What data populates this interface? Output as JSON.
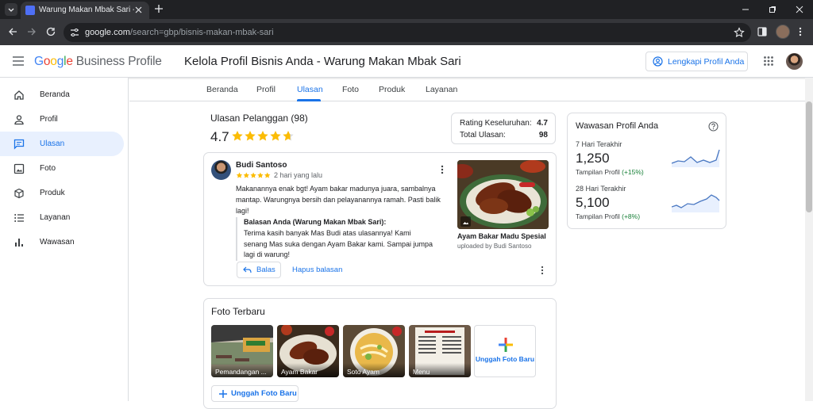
{
  "browser": {
    "tab_title": "Warung Makan Mbak Sari - W",
    "url_host": "google.com",
    "url_path": "/search=gbp/bisnis-makan-mbak-sari"
  },
  "header": {
    "logo_google": "Google",
    "logo_product": "Business Profile",
    "title": "Kelola Profil Bisnis Anda - Warung Makan Mbak Sari",
    "complete_button": "Lengkapi Profil Anda"
  },
  "sidebar": {
    "items": [
      {
        "label": "Beranda",
        "icon": "home-icon"
      },
      {
        "label": "Profil",
        "icon": "person-icon"
      },
      {
        "label": "Ulasan",
        "icon": "reviews-icon",
        "active": true
      },
      {
        "label": "Foto",
        "icon": "photo-icon"
      },
      {
        "label": "Produk",
        "icon": "product-box-icon"
      },
      {
        "label": "Layanan",
        "icon": "list-icon"
      },
      {
        "label": "Wawasan",
        "icon": "bar-chart-icon"
      }
    ]
  },
  "tabs": [
    "Beranda",
    "Profil",
    "Ulasan",
    "Foto",
    "Produk",
    "Layanan"
  ],
  "active_tab": "Ulasan",
  "reviews": {
    "heading": "Ulasan Pelanggan (98)",
    "average": "4.7",
    "rating_label": "Rating Keseluruhan:",
    "rating_value": "4.7",
    "total_label": "Total Ulasan:",
    "total_value": "98",
    "review": {
      "author": "Budi Santoso",
      "stars": 5,
      "time": "2 hari yang lalu",
      "text": "Makanannya enak bgt! Ayam bakar madunya juara, sambalnya mantap. Warungnya bersih dan pelayanannya ramah. Pasti balik lagi!",
      "reply_label": "Balasan Anda (Warung Makan Mbak Sari):",
      "reply_text": "Terima kasih banyak Mas Budi atas ulasannya! Kami senang Mas suka dengan Ayam Bakar kami. Sampai jumpa lagi di warung!",
      "reply_button": "Balas",
      "delete_reply": "Hapus balasan",
      "photo_title": "Ayam Bakar Madu Spesial",
      "photo_sub": "uploaded by Budi Santoso"
    }
  },
  "photos": {
    "heading": "Foto Terbaru",
    "items": [
      "Pemandangan ...",
      "Ayam Bakar",
      "Soto Ayam",
      "Menu"
    ],
    "upload_tile": "Unggah Foto Baru",
    "upload_button": "Unggah Foto Baru"
  },
  "insights": {
    "title": "Wawasan Profil Anda",
    "periods": [
      {
        "label": "7 Hari Terakhir",
        "value": "1,250",
        "sub": "Tampilan Profil",
        "change": "(+15%)"
      },
      {
        "label": "28 Hari Terakhir",
        "value": "5,100",
        "sub": "Tampilan Profil",
        "change": "(+8%)"
      }
    ]
  },
  "colors": {
    "accent": "#1a73e8",
    "positive": "#188038",
    "star": "#fbbc04"
  }
}
